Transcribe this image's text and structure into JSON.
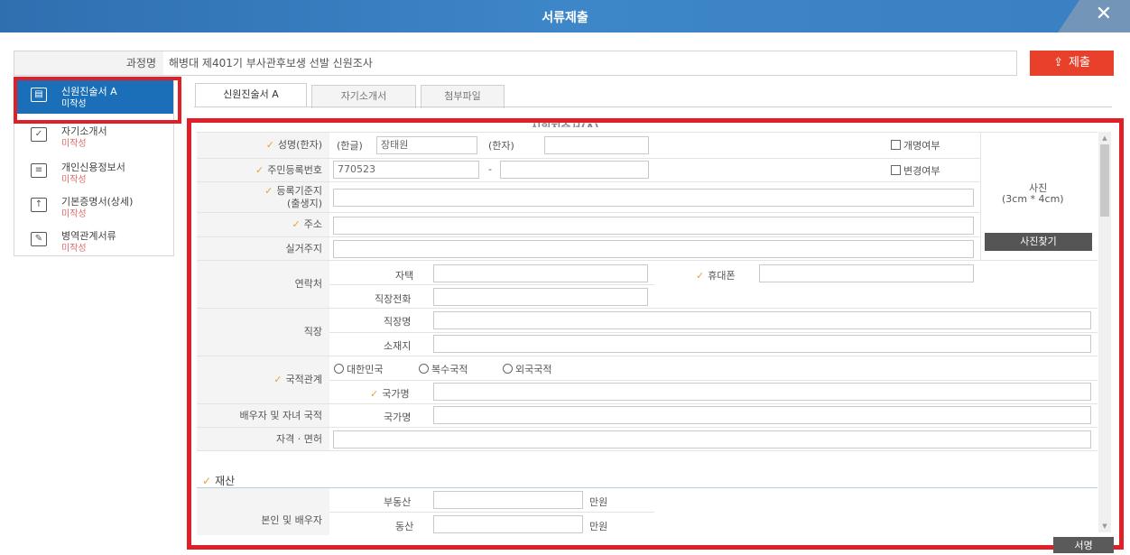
{
  "window": {
    "title": "서류제출",
    "close": "✕"
  },
  "course": {
    "label": "과정명",
    "value": "해병대 제401기 부사관후보생 선발 신원조사"
  },
  "submit_label": "제출",
  "sidebar": {
    "items": [
      {
        "label": "신원진술서 A",
        "status": "미작성"
      },
      {
        "label": "자기소개서",
        "status": "미작성"
      },
      {
        "label": "개인신용정보서",
        "status": "미작성"
      },
      {
        "label": "기본증명서(상세)",
        "status": "미작성"
      },
      {
        "label": "병역관계서류",
        "status": "미작성"
      }
    ]
  },
  "tabs": [
    "신원진술서 A",
    "자기소개서",
    "첨부파일"
  ],
  "form_title": "신원진술서(A)",
  "form": {
    "name_label": "성명(한자)",
    "hangul_label": "(한글)",
    "hangul_value": "장태원",
    "hanja_label": "(한자)",
    "name_change": "개명여부",
    "rrn_label": "주민등록번호",
    "rrn_front": "770523",
    "rrn_dash": "-",
    "rrn_change": "변경여부",
    "reg_label_1": "등록기준지",
    "reg_label_2": "(출생지)",
    "addr_label": "주소",
    "real_addr_label": "실거주지",
    "photo_label": "사진",
    "photo_size": "(3cm * 4cm)",
    "photo_button": "사진찾기",
    "contact_label": "연락처",
    "home_label": "자택",
    "mobile_label": "휴대폰",
    "work_phone_label": "직장전화",
    "job_label": "직장",
    "job_name_label": "직장명",
    "job_addr_label": "소재지",
    "nation_label": "국적관계",
    "nation_options": [
      "대한민국",
      "복수국적",
      "외국국적"
    ],
    "country_label": "국가명",
    "family_label": "배우자 및 자녀 국적",
    "family_country_label": "국가명",
    "license_label": "자격 · 면허",
    "assets_title": "재산",
    "assets_owner": "본인 및 배우자",
    "real_estate_label": "부동산",
    "movable_label": "동산",
    "unit": "만원",
    "sign_button": "서명"
  }
}
